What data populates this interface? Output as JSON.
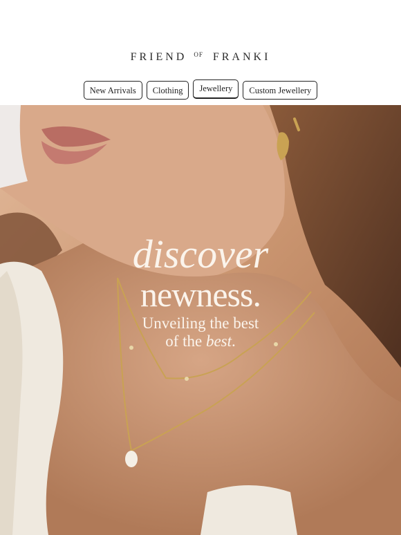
{
  "brand": {
    "part1": "FRIEND",
    "part2": "OF",
    "part3": "FRANKI"
  },
  "nav": [
    {
      "label": "New Arrivals"
    },
    {
      "label": "Clothing"
    },
    {
      "label": "Jewellery"
    },
    {
      "label": "Custom Jewellery"
    }
  ],
  "hero": {
    "line1": "discover",
    "line2": "newness.",
    "sub1": "Unveiling the best",
    "sub2a": "of the ",
    "sub2b": "best",
    "sub2c": "."
  },
  "colors": {
    "headline": "#fbf4ec",
    "skin": "#c99a7a",
    "gold": "#c9a253",
    "hair": "#6b4630"
  }
}
